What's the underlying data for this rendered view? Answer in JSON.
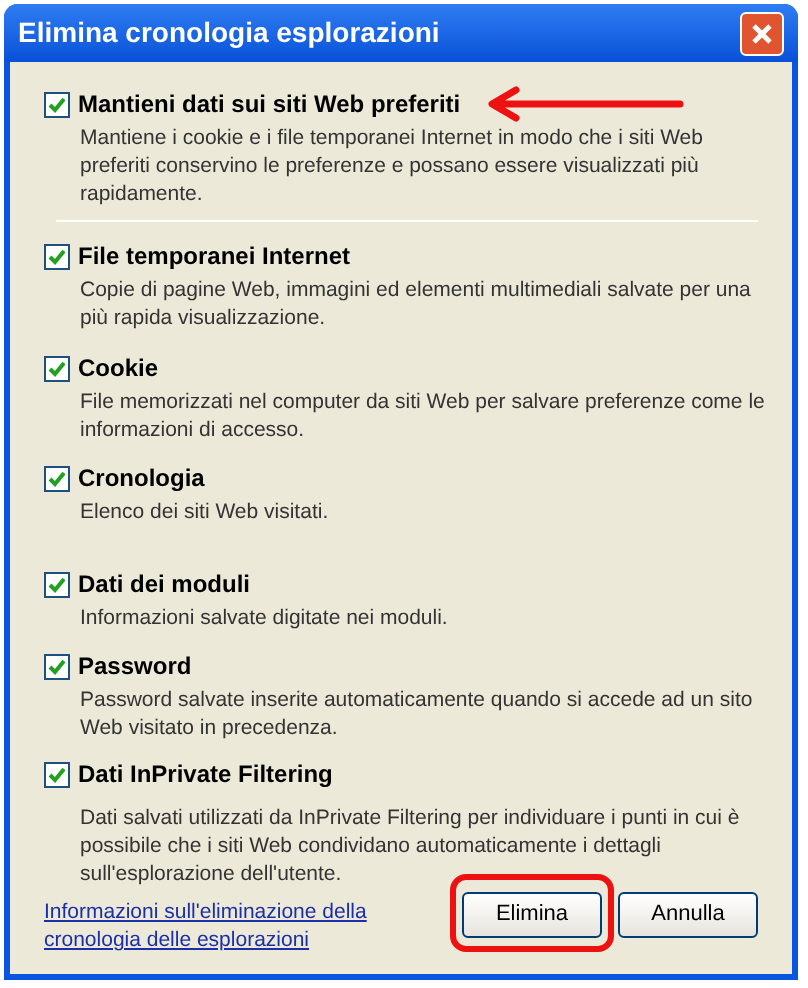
{
  "window": {
    "title": "Elimina cronologia esplorazioni"
  },
  "options": [
    {
      "label": "Mantieni dati sui siti Web preferiti",
      "description": "Mantiene i cookie e i file temporanei Internet in modo che i siti Web preferiti conservino le preferenze e possano essere visualizzati più rapidamente.",
      "checked": true,
      "arrow": true
    },
    {
      "label": "File temporanei Internet",
      "description": "Copie di pagine Web, immagini ed elementi multimediali salvate per una più rapida visualizzazione.",
      "checked": true,
      "arrow": false
    },
    {
      "label": "Cookie",
      "description": "File memorizzati nel computer da siti Web per salvare preferenze come le informazioni di accesso.",
      "checked": true,
      "arrow": false
    },
    {
      "label": "Cronologia",
      "description": "Elenco dei siti Web visitati.",
      "checked": true,
      "arrow": false
    },
    {
      "label": "Dati dei moduli",
      "description": "Informazioni salvate digitate nei moduli.",
      "checked": true,
      "arrow": false
    },
    {
      "label": "Password",
      "description": "Password salvate inserite automaticamente quando si accede ad un sito Web visitato in precedenza.",
      "checked": true,
      "arrow": false
    },
    {
      "label": "Dati InPrivate Filtering",
      "description": "Dati salvati utilizzati da InPrivate Filtering per individuare i punti in cui è possibile che i siti Web condividano automaticamente i dettagli sull'esplorazione dell'utente.",
      "checked": true,
      "arrow": false
    }
  ],
  "help_link": "Informazioni sull'eliminazione della cronologia delle esplorazioni",
  "buttons": [
    {
      "label": "Elimina",
      "highlighted": true
    },
    {
      "label": "Annulla",
      "highlighted": false
    }
  ]
}
